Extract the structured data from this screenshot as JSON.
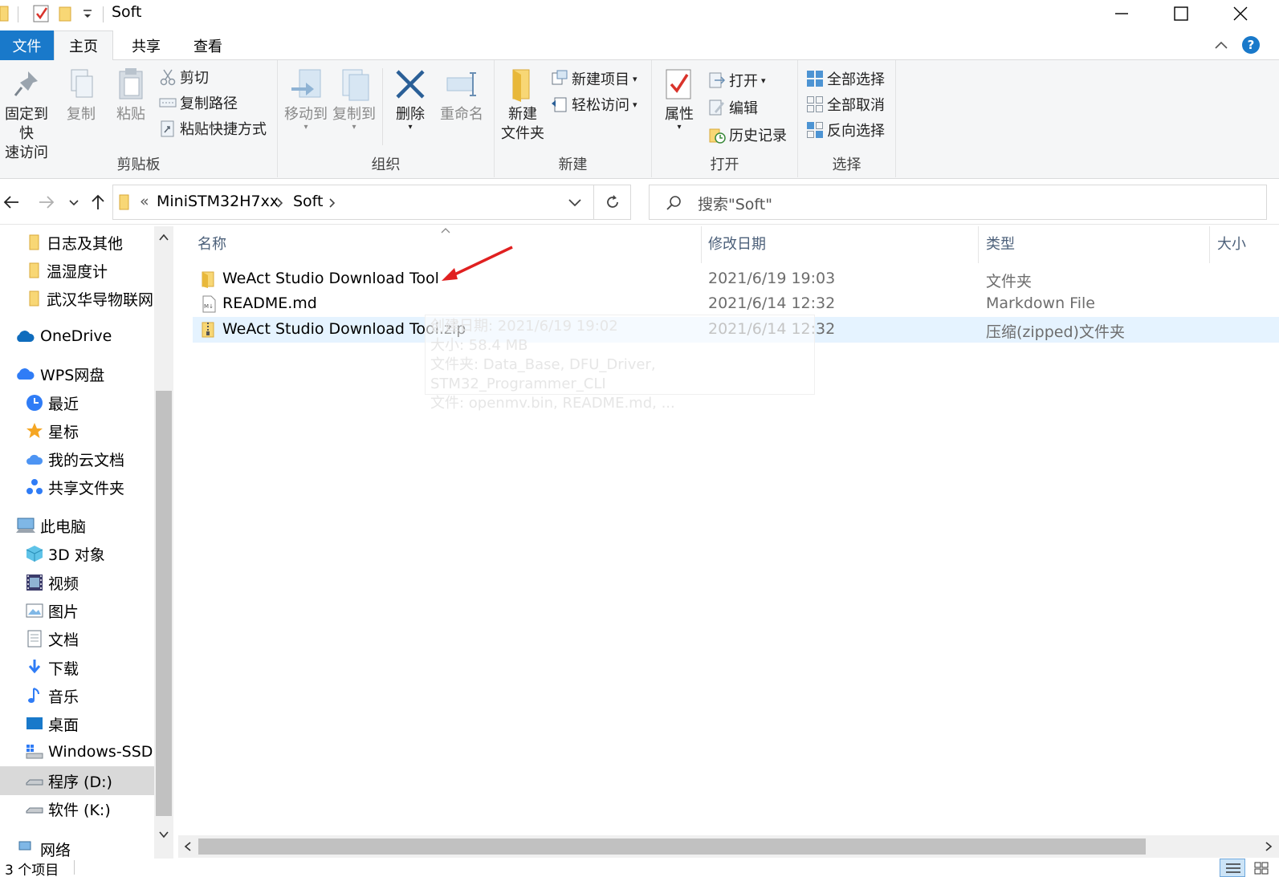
{
  "window": {
    "title": "Soft",
    "controls": {
      "minimize": "minimize-icon",
      "maximize": "maximize-icon",
      "close": "close-icon"
    }
  },
  "tabs": [
    {
      "label": "文件"
    },
    {
      "label": "主页"
    },
    {
      "label": "共享"
    },
    {
      "label": "查看"
    }
  ],
  "ribbon": {
    "clipboard": {
      "label": "剪贴板",
      "pin_line1": "固定到快",
      "pin_line2": "速访问",
      "copy": "复制",
      "paste": "粘贴",
      "cut": "剪切",
      "copy_path": "复制路径",
      "paste_shortcut": "粘贴快捷方式"
    },
    "organize": {
      "label": "组织",
      "move_to": "移动到",
      "copy_to": "复制到",
      "delete": "删除",
      "rename": "重命名"
    },
    "new": {
      "label": "新建",
      "new_folder_line1": "新建",
      "new_folder_line2": "文件夹",
      "new_item": "新建项目",
      "easy_access": "轻松访问"
    },
    "open": {
      "label": "打开",
      "properties": "属性",
      "open": "打开",
      "edit": "编辑",
      "history": "历史记录"
    },
    "select": {
      "label": "选择",
      "select_all": "全部选择",
      "select_none": "全部取消",
      "invert": "反向选择"
    }
  },
  "address": {
    "overflow": "«",
    "crumbs": [
      "MiniSTM32H7xx",
      "Soft"
    ],
    "search_placeholder": "搜索\"Soft\""
  },
  "nav": {
    "quick_items": [
      "日志及其他",
      "温湿度计",
      "武汉华导物联网"
    ],
    "onedrive": "OneDrive",
    "wps": "WPS网盘",
    "wps_items": [
      "最近",
      "星标",
      "我的云文档",
      "共享文件夹"
    ],
    "this_pc": "此电脑",
    "pc_items": [
      "3D 对象",
      "视频",
      "图片",
      "文档",
      "下载",
      "音乐",
      "桌面",
      "Windows-SSD (",
      "程序 (D:)",
      "软件 (K:)"
    ],
    "network_partial": "网络"
  },
  "columns": {
    "name": "名称",
    "modified": "修改日期",
    "type": "类型",
    "size": "大小"
  },
  "files": [
    {
      "name": "WeAct Studio Download Tool",
      "modified": "2021/6/19 19:03",
      "type": "文件夹"
    },
    {
      "name": "README.md",
      "modified": "2021/6/14 12:32",
      "type": "Markdown File"
    },
    {
      "name": "WeAct Studio Download Tool.zip",
      "modified": "2021/6/14 12:32",
      "type": "压缩(zipped)文件夹"
    }
  ],
  "tooltip": {
    "line1": "创建日期: 2021/6/19 19:02",
    "line2": "大小: 58.4 MB",
    "line3": "文件夹: Data_Base, DFU_Driver, STM32_Programmer_CLI",
    "line4": "文件: openmv.bin, README.md, ..."
  },
  "status": {
    "count": "3 个项目"
  },
  "colors": {
    "accent": "#1979ca",
    "selected_row": "#e5f3ff",
    "folder": "#f8d775",
    "arrow": "#e02020"
  }
}
